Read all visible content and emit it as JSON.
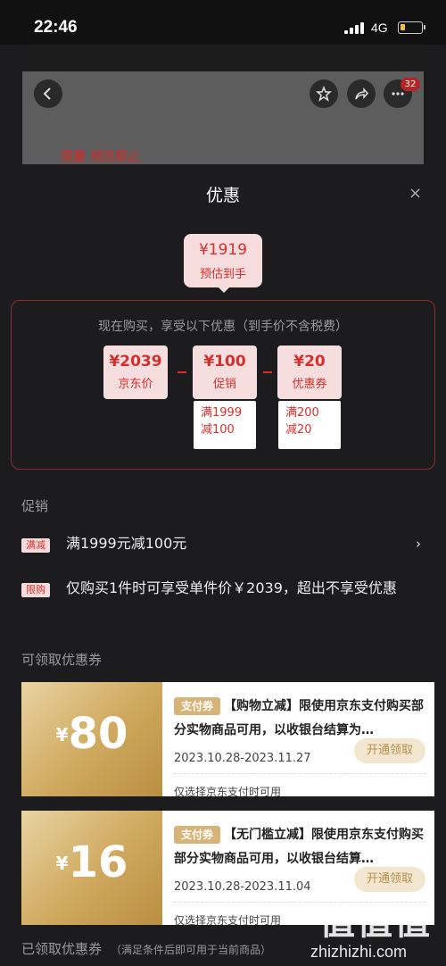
{
  "status_bar": {
    "time": "22:46",
    "network": "4G",
    "battery_level": 0.22
  },
  "background_page": {
    "promo_text": "限量 领完即止",
    "cart_badge": "32"
  },
  "sheet": {
    "title": "优惠",
    "close_glyph": "×",
    "final_price": {
      "amount": "¥1919",
      "label": "预估到手"
    },
    "calc": {
      "caption": "现在购买，享受以下优惠（到手价不含税费）",
      "items": [
        {
          "amount": "¥2039",
          "label": "京东价"
        },
        {
          "amount": "¥100",
          "label": "促销",
          "sub_line1": "满1999",
          "sub_line2": "减100"
        },
        {
          "amount": "¥20",
          "label": "优惠券",
          "sub_line1": "满200",
          "sub_line2": "减20"
        }
      ]
    },
    "promotions": {
      "heading": "促销",
      "rows": [
        {
          "tag": "满减",
          "text": "满1999元减100元"
        },
        {
          "tag": "限购",
          "text": "仅购买1件时可享受单件价￥2039，超出不享受优惠"
        }
      ]
    },
    "coupons": {
      "heading": "可领取优惠券",
      "items": [
        {
          "yen": "¥",
          "value": "80",
          "tag": "支付券",
          "title": "【购物立减】限使用京东支付购买部分实物商品可用，以收银台结算为…",
          "dates": "2023.10.28-2023.11.27",
          "button": "开通领取",
          "note": "仅选择京东支付时可用"
        },
        {
          "yen": "¥",
          "value": "16",
          "tag": "支付券",
          "title": "【无门槛立减】限使用京东支付购买部分实物商品可用，以收银台结算…",
          "dates": "2023.10.28-2023.11.04",
          "button": "开通领取",
          "note": "仅选择京东支付时可用"
        }
      ]
    },
    "received": {
      "heading": "已领取优惠券",
      "hint": "（满足条件后即可用于当前商品）"
    }
  },
  "watermark": {
    "logo": "值值值",
    "url": "zhizhizhi.com"
  },
  "colors": {
    "accent": "#d4302d",
    "gold": "#cfa85d",
    "sheet_bg": "#1c1c1e"
  }
}
